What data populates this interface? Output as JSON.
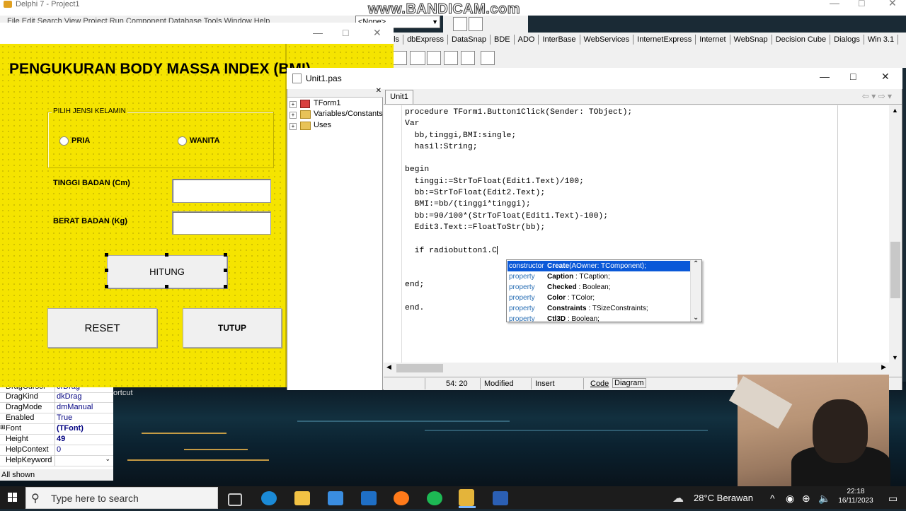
{
  "ide": {
    "title": "Delphi 7 - Project1",
    "menu": "File  Edit  Search  View  Project  Run  Component  Database  Tools  Window  Help",
    "combo": "<None>",
    "palette_tabs": [
      "pls",
      "dbExpress",
      "DataSnap",
      "BDE",
      "ADO",
      "InterBase",
      "WebServices",
      "InternetExpress",
      "Internet",
      "WebSnap",
      "Decision Cube",
      "Dialogs",
      "Win 3.1"
    ]
  },
  "watermark": "www.BANDICAM.com",
  "form": {
    "title": "PENGUKURAN BODY MASSA INDEX (BMI)",
    "group_label": "PILIH JENSI KELAMIN",
    "radio_pria": "PRIA",
    "radio_wanita": "WANITA",
    "label_tinggi": "TINGGI BADAN (Cm)",
    "label_berat": "BERAT BADAN (Kg)",
    "edit_tinggi": "",
    "edit_berat": "",
    "btn_hitung": "HITUNG",
    "btn_reset": "RESET",
    "btn_tutup": "TUTUP"
  },
  "editor": {
    "title": "Unit1.pas",
    "tab": "Unit1",
    "tree": [
      "TForm1",
      "Variables/Constants",
      "Uses"
    ],
    "code_lines": [
      "procedure TForm1.Button1Click(Sender: TObject);",
      "Var",
      "  bb,tinggi,BMI:single;",
      "  hasil:String;",
      "",
      "begin",
      "  tinggi:=StrToFloat(Edit1.Text)/100;",
      "  bb:=StrToFloat(Edit2.Text);",
      "  BMI:=bb/(tinggi*tinggi);",
      "  bb:=90/100*(StrToFloat(Edit1.Text)-100);",
      "  Edit3.Text:=FloatToStr(bb);",
      "",
      "  if radiobutton1.C",
      "",
      "",
      "end;",
      "",
      "end."
    ],
    "status": {
      "position": "54: 20",
      "modified": "Modified",
      "mode": "Insert",
      "tab_code": "Code",
      "tab_diagram": "Diagram"
    },
    "completion": [
      {
        "kind": "constructor",
        "name": "Create",
        "sig": "(AOwner: TComponent);"
      },
      {
        "kind": "property",
        "name": "Caption",
        "sig": " : TCaption;"
      },
      {
        "kind": "property",
        "name": "Checked",
        "sig": " : Boolean;"
      },
      {
        "kind": "property",
        "name": "Color",
        "sig": " : TColor;"
      },
      {
        "kind": "property",
        "name": "Constraints",
        "sig": " : TSizeConstraints;"
      },
      {
        "kind": "property",
        "name": "Ctl3D",
        "sig": " : Boolean;"
      }
    ]
  },
  "inspector": {
    "rows": [
      {
        "name": "DragCursor",
        "value": "crDrag"
      },
      {
        "name": "DragKind",
        "value": "dkDrag"
      },
      {
        "name": "DragMode",
        "value": "dmManual"
      },
      {
        "name": "Enabled",
        "value": "True"
      },
      {
        "name": "Font",
        "value": "(TFont)"
      },
      {
        "name": "Height",
        "value": "49"
      },
      {
        "name": "HelpContext",
        "value": "0"
      },
      {
        "name": "HelpKeyword",
        "value": ""
      }
    ],
    "footer": "All shown",
    "shortcut": "ortcut"
  },
  "taskbar": {
    "search_placeholder": "Type here to search",
    "weather": "28°C  Berawan",
    "time": "22:18",
    "date": "16/11/2023"
  }
}
